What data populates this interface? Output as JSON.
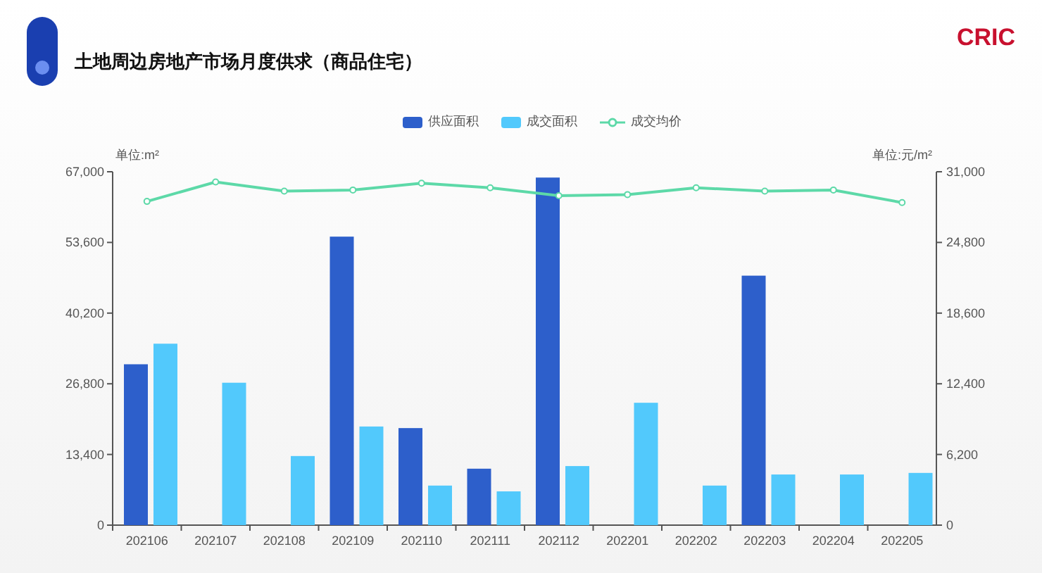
{
  "header": {
    "title": "土地周边房地产市场月度供求（商品住宅）",
    "logo": "CRIC"
  },
  "chart": {
    "chart_data": {
      "type": "bar",
      "ylabel": "单位:m²",
      "y2label": "单位:元/m²",
      "categories": [
        "202106",
        "202107",
        "202108",
        "202109",
        "202110",
        "202111",
        "202112",
        "202201",
        "202202",
        "202203",
        "202204",
        "202205"
      ],
      "series": [
        {
          "name": "供应面积",
          "color": "#2d5fcb",
          "values": [
            30500,
            null,
            null,
            54700,
            18400,
            10700,
            65900,
            null,
            null,
            47300,
            null,
            null
          ]
        },
        {
          "name": "成交面积",
          "color": "#52c9fc",
          "values": [
            34400,
            27000,
            13100,
            18700,
            7500,
            6400,
            11200,
            23200,
            7500,
            9600,
            9600,
            9900
          ]
        },
        {
          "name": "成交均价",
          "type": "line",
          "marker": "circle",
          "axis": "y2",
          "color": "#5dd9a8",
          "values": [
            28400,
            30100,
            29300,
            29400,
            30000,
            29600,
            28900,
            29000,
            29600,
            29300,
            29400,
            28300
          ]
        }
      ],
      "ylim": [
        0,
        67000
      ],
      "yticks": [
        {
          "value": 0,
          "label": "0"
        },
        {
          "value": 13400,
          "label": "13,400"
        },
        {
          "value": 26800,
          "label": "26,800"
        },
        {
          "value": 40200,
          "label": "40,200"
        },
        {
          "value": 53600,
          "label": "53,600"
        },
        {
          "value": 67000,
          "label": "67,000"
        }
      ],
      "y2lim": [
        0,
        31000
      ],
      "y2ticks": [
        {
          "value": 0,
          "label": "0"
        },
        {
          "value": 6200,
          "label": "6,200"
        },
        {
          "value": 12400,
          "label": "12,400"
        },
        {
          "value": 18600,
          "label": "18,600"
        },
        {
          "value": 24800,
          "label": "24,800"
        },
        {
          "value": 31000,
          "label": "31,000"
        }
      ]
    }
  }
}
